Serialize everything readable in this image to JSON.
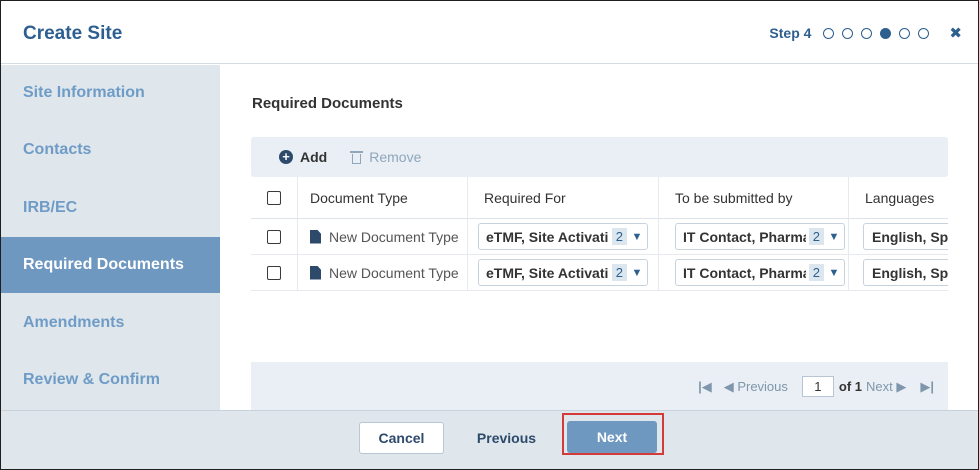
{
  "header": {
    "title": "Create Site",
    "step_label": "Step 4",
    "steps_total": 6,
    "current_step": 4,
    "close_icon": "close-icon"
  },
  "sidebar": {
    "items": [
      {
        "label": "Site Information",
        "active": false
      },
      {
        "label": "Contacts",
        "active": false
      },
      {
        "label": "IRB/EC",
        "active": false
      },
      {
        "label": "Required Documents",
        "active": true
      },
      {
        "label": "Amendments",
        "active": false
      },
      {
        "label": "Review & Confirm",
        "active": false
      }
    ]
  },
  "main": {
    "section_title": "Required Documents",
    "toolbar": {
      "add_label": "Add",
      "remove_label": "Remove"
    },
    "grid": {
      "columns": [
        "Document Type",
        "Required For",
        "To be submitted by",
        "Languages"
      ],
      "rows": [
        {
          "document_type": "New Document Type",
          "required_for": "eTMF, Site Activation",
          "required_for_count": "2",
          "submitted_by": "IT Contact, Pharmacy",
          "submitted_by_count": "2",
          "languages": "English, Spanish"
        },
        {
          "document_type": "New Document Type",
          "required_for": "eTMF, Site Activation",
          "required_for_count": "2",
          "submitted_by": "IT Contact, Pharmacy",
          "submitted_by_count": "2",
          "languages": "English, Spanish"
        }
      ]
    },
    "pager": {
      "previous_label": "Previous",
      "page_value": "1",
      "of_label": "of 1",
      "next_label": "Next"
    }
  },
  "footer": {
    "cancel_label": "Cancel",
    "previous_label": "Previous",
    "next_label": "Next"
  },
  "colors": {
    "accent": "#2d5f8f",
    "sidebar_bg": "#dfe6ec",
    "active_nav": "#6e98c0",
    "highlight": "#d33b3b"
  }
}
